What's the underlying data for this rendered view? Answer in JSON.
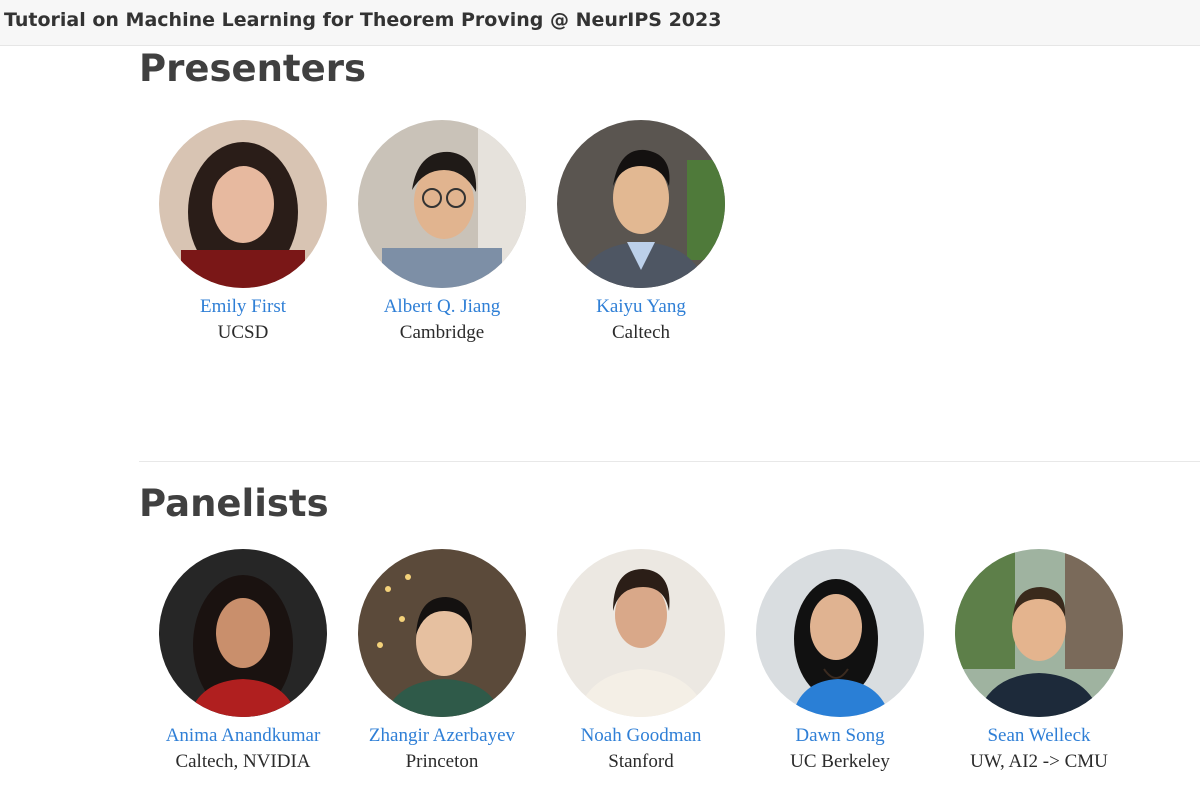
{
  "header": {
    "site_title": "Tutorial on Machine Learning for Theorem Proving @ NeurIPS 2023"
  },
  "presenters": {
    "heading": "Presenters",
    "people": [
      {
        "name": "Emily First",
        "affiliation": "UCSD"
      },
      {
        "name": "Albert Q. Jiang",
        "affiliation": "Cambridge"
      },
      {
        "name": "Kaiyu Yang",
        "affiliation": "Caltech"
      }
    ]
  },
  "panelists": {
    "heading": "Panelists",
    "people": [
      {
        "name": "Anima Anandkumar",
        "affiliation": "Caltech, NVIDIA"
      },
      {
        "name": "Zhangir Azerbayev",
        "affiliation": "Princeton"
      },
      {
        "name": "Noah Goodman",
        "affiliation": "Stanford"
      },
      {
        "name": "Dawn Song",
        "affiliation": "UC Berkeley"
      },
      {
        "name": "Sean Welleck",
        "affiliation": "UW, AI2 -> CMU"
      }
    ]
  },
  "colors": {
    "link": "#2f7fd6",
    "heading": "#404040",
    "text": "#2b2b2b"
  }
}
